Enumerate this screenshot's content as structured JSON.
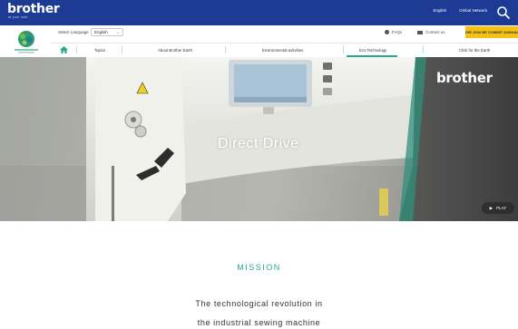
{
  "header": {
    "logo_text": "brother",
    "logo_subtext": "at your side",
    "links": [
      "English",
      "Global Network"
    ],
    "search_icon": "search-icon",
    "brand_color": "#1d3a94"
  },
  "subheader": {
    "language_label": "Select Language",
    "language_value": "English",
    "faq_label": "FAQs",
    "contact_label": "Contact us",
    "cta_label": "THE 2030 BE COMMIT ANNUAL",
    "cta_color": "#f5c211"
  },
  "nav": {
    "items": [
      "Topics",
      "About Brother Earth",
      "Environmental activities",
      "Eco Technology",
      "Click for the Earth"
    ],
    "active_index": 3,
    "accent_color": "#2aa88f"
  },
  "hero": {
    "title": "Direct Drive",
    "brand_text": "brother",
    "play_label": "PLAY"
  },
  "mission": {
    "heading": "MISSION",
    "line1": "The technological revolution in",
    "line2": "the industrial sewing machine"
  }
}
